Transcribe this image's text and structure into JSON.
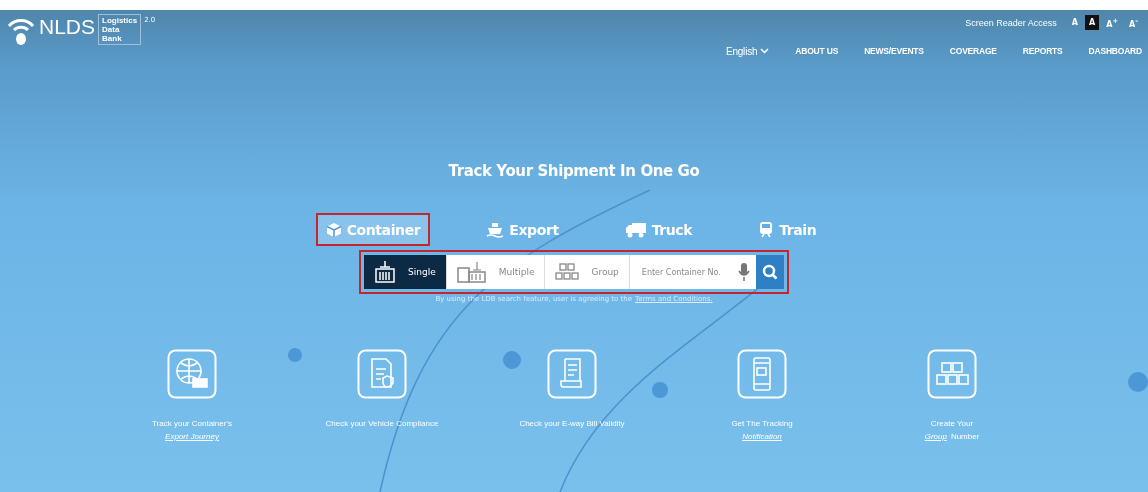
{
  "logo": {
    "name": "NLDS",
    "words": [
      "Logistics",
      "Data",
      "Bank"
    ],
    "version": "2.0"
  },
  "accessibility": {
    "label": "Screen Reader Access",
    "font_buttons": [
      {
        "label": "A",
        "selected": false
      },
      {
        "label": "A",
        "selected": true
      },
      {
        "label": "A$^{+}$",
        "selected": false
      },
      {
        "label": "A$^{-}$",
        "selected": false
      }
    ]
  },
  "nav": {
    "language": "English",
    "items": [
      "ABOUT US",
      "NEWS/EVENTS",
      "COVERAGE",
      "REPORTS",
      "DASHBOARD"
    ]
  },
  "hero": {
    "title": "Track Your Shipment In One Go"
  },
  "tabs": [
    {
      "label": "Container",
      "kind": "container",
      "selected": true
    },
    {
      "label": "Export",
      "kind": "ship",
      "selected": false
    },
    {
      "label": "Truck",
      "kind": "truck",
      "selected": false
    },
    {
      "label": "Train",
      "kind": "train",
      "selected": false
    }
  ],
  "search": {
    "modes": [
      {
        "label": "Single",
        "kind": "single",
        "selected": true
      },
      {
        "label": "Multiple",
        "kind": "multiple",
        "selected": false
      },
      {
        "label": "Group",
        "kind": "group",
        "selected": false
      }
    ],
    "placeholder": "Enter Container No.",
    "disclaimer": "By using the LDB search feature, user is agreeing to the",
    "disclaimer_link": "Terms and Conditions."
  },
  "features": [
    {
      "kind": "globe",
      "text": "Track your Container's",
      "link": "Export Journey"
    },
    {
      "kind": "document",
      "text": "Check your Vehicle Compliance"
    },
    {
      "kind": "receipt",
      "text": "Check your E-way Bill Validity"
    },
    {
      "kind": "phone",
      "text": "Get The Tracking",
      "link": "Notification"
    },
    {
      "kind": "containers",
      "text": "Create Your",
      "link": "Group",
      "suffix": "Number"
    }
  ]
}
